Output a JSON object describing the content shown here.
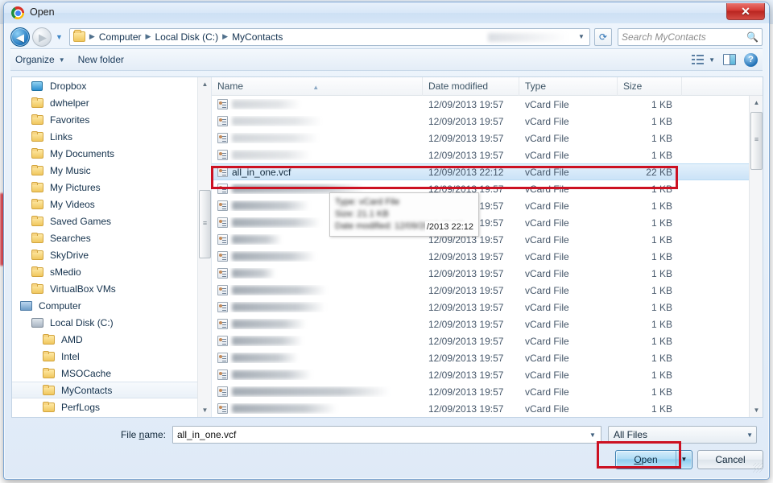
{
  "window": {
    "title": "Open",
    "app_icon": "chrome-icon",
    "close_label": "✕"
  },
  "navigation": {
    "back_icon": "back-arrow-icon",
    "forward_icon": "forward-arrow-icon",
    "recent_icon": "chevron-down-icon",
    "breadcrumbs": [
      "Computer",
      "Local Disk (C:)",
      "MyContacts"
    ],
    "refresh_icon": "refresh-icon",
    "address_dropdown_icon": "chevron-down-icon"
  },
  "search": {
    "placeholder": "Search MyContacts",
    "icon": "search-icon"
  },
  "toolbar": {
    "organize_label": "Organize",
    "organize_caret": "▼",
    "new_folder_label": "New folder",
    "views_icon": "list-view-icon",
    "views_caret": "▼",
    "preview_pane_icon": "preview-pane-icon",
    "help_icon": "help-icon",
    "help_label": "?"
  },
  "sidebar": {
    "items": [
      {
        "label": "Dropbox",
        "icon": "dropbox-icon",
        "indent": 1,
        "selected": false
      },
      {
        "label": "dwhelper",
        "icon": "folder-icon",
        "indent": 1,
        "selected": false
      },
      {
        "label": "Favorites",
        "icon": "folder-icon",
        "indent": 1,
        "selected": false
      },
      {
        "label": "Links",
        "icon": "folder-icon",
        "indent": 1,
        "selected": false
      },
      {
        "label": "My Documents",
        "icon": "folder-icon",
        "indent": 1,
        "selected": false
      },
      {
        "label": "My Music",
        "icon": "folder-icon",
        "indent": 1,
        "selected": false
      },
      {
        "label": "My Pictures",
        "icon": "folder-icon",
        "indent": 1,
        "selected": false
      },
      {
        "label": "My Videos",
        "icon": "folder-icon",
        "indent": 1,
        "selected": false
      },
      {
        "label": "Saved Games",
        "icon": "folder-icon",
        "indent": 1,
        "selected": false
      },
      {
        "label": "Searches",
        "icon": "folder-icon",
        "indent": 1,
        "selected": false
      },
      {
        "label": "SkyDrive",
        "icon": "folder-icon",
        "indent": 1,
        "selected": false
      },
      {
        "label": "sMedio",
        "icon": "folder-icon",
        "indent": 1,
        "selected": false
      },
      {
        "label": "VirtualBox VMs",
        "icon": "folder-icon",
        "indent": 1,
        "selected": false
      },
      {
        "label": "Computer",
        "icon": "computer-icon",
        "indent": 0,
        "selected": false
      },
      {
        "label": "Local Disk (C:)",
        "icon": "disk-icon",
        "indent": 1,
        "selected": false
      },
      {
        "label": "AMD",
        "icon": "folder-icon",
        "indent": 2,
        "selected": false
      },
      {
        "label": "Intel",
        "icon": "folder-icon",
        "indent": 2,
        "selected": false
      },
      {
        "label": "MSOCache",
        "icon": "folder-icon",
        "indent": 2,
        "selected": false
      },
      {
        "label": "MyContacts",
        "icon": "folder-icon",
        "indent": 2,
        "selected": true
      },
      {
        "label": "PerfLogs",
        "icon": "folder-icon",
        "indent": 2,
        "selected": false
      }
    ],
    "scroll_up_icon": "scroll-up-icon",
    "scroll_down_icon": "scroll-down-icon"
  },
  "filelist": {
    "columns": [
      "Name",
      "Date modified",
      "Type",
      "Size"
    ],
    "sort_column": "Name",
    "sort_caret": "▲",
    "rows": [
      {
        "name": "",
        "redacted": true,
        "name_width": 85,
        "date": "12/09/2013 19:57",
        "type": "vCard File",
        "size": "1 KB",
        "selected": false
      },
      {
        "name": "",
        "redacted": true,
        "name_width": 112,
        "date": "12/09/2013 19:57",
        "type": "vCard File",
        "size": "1 KB",
        "selected": false
      },
      {
        "name": "",
        "redacted": true,
        "name_width": 108,
        "date": "12/09/2013 19:57",
        "type": "vCard File",
        "size": "1 KB",
        "selected": false
      },
      {
        "name": "",
        "redacted": true,
        "name_width": 98,
        "date": "12/09/2013 19:57",
        "type": "vCard File",
        "size": "1 KB",
        "selected": false
      },
      {
        "name": "all_in_one.vcf",
        "redacted": false,
        "name_width": 0,
        "date": "12/09/2013 22:12",
        "type": "vCard File",
        "size": "22 KB",
        "selected": true
      },
      {
        "name": "",
        "redacted": true,
        "name_width": 165,
        "date": "12/09/2013 19:57",
        "type": "vCard File",
        "size": "1 KB",
        "selected": false
      },
      {
        "name": "",
        "redacted": true,
        "name_width": 96,
        "date": "12/09/2013 19:57",
        "type": "vCard File",
        "size": "1 KB",
        "selected": false
      },
      {
        "name": "",
        "redacted": true,
        "name_width": 110,
        "date": "12/09/2013 19:57",
        "type": "vCard File",
        "size": "1 KB",
        "selected": false
      },
      {
        "name": "",
        "redacted": true,
        "name_width": 62,
        "date": "12/09/2013 19:57",
        "type": "vCard File",
        "size": "1 KB",
        "selected": false
      },
      {
        "name": "",
        "redacted": true,
        "name_width": 104,
        "date": "12/09/2013 19:57",
        "type": "vCard File",
        "size": "1 KB",
        "selected": false
      },
      {
        "name": "",
        "redacted": true,
        "name_width": 54,
        "date": "12/09/2013 19:57",
        "type": "vCard File",
        "size": "1 KB",
        "selected": false
      },
      {
        "name": "",
        "redacted": true,
        "name_width": 118,
        "date": "12/09/2013 19:57",
        "type": "vCard File",
        "size": "1 KB",
        "selected": false
      },
      {
        "name": "",
        "redacted": true,
        "name_width": 116,
        "date": "12/09/2013 19:57",
        "type": "vCard File",
        "size": "1 KB",
        "selected": false
      },
      {
        "name": "",
        "redacted": true,
        "name_width": 92,
        "date": "12/09/2013 19:57",
        "type": "vCard File",
        "size": "1 KB",
        "selected": false
      },
      {
        "name": "",
        "redacted": true,
        "name_width": 88,
        "date": "12/09/2013 19:57",
        "type": "vCard File",
        "size": "1 KB",
        "selected": false
      },
      {
        "name": "",
        "redacted": true,
        "name_width": 82,
        "date": "12/09/2013 19:57",
        "type": "vCard File",
        "size": "1 KB",
        "selected": false
      },
      {
        "name": "",
        "redacted": true,
        "name_width": 99,
        "date": "12/09/2013 19:57",
        "type": "vCard File",
        "size": "1 KB",
        "selected": false
      },
      {
        "name": "",
        "redacted": true,
        "name_width": 196,
        "date": "12/09/2013 19:57",
        "type": "vCard File",
        "size": "1 KB",
        "selected": false
      },
      {
        "name": "",
        "redacted": true,
        "name_width": 130,
        "date": "12/09/2013 19:57",
        "type": "vCard File",
        "size": "1 KB",
        "selected": false
      }
    ]
  },
  "tooltip": {
    "lines": [
      "Type: vCard File",
      "Size: 21.1 KB",
      "Date modified: 12/09/2013 22:12"
    ],
    "visible_text": "/2013 22:12"
  },
  "bottom": {
    "filename_label_pre": "File ",
    "filename_label_accel": "n",
    "filename_label_post": "ame:",
    "filename_value": "all_in_one.vcf",
    "filename_dropdown_icon": "chevron-down-icon",
    "filter_value": "All Files",
    "filter_dropdown_icon": "chevron-down-icon",
    "open_label_pre": "",
    "open_label_accel": "O",
    "open_label_post": "pen",
    "open_split_icon": "chevron-down-icon",
    "cancel_label": "Cancel"
  },
  "annotations": {
    "selected_row_highlight": "#cc1122",
    "open_button_highlight": "#cc1122"
  }
}
